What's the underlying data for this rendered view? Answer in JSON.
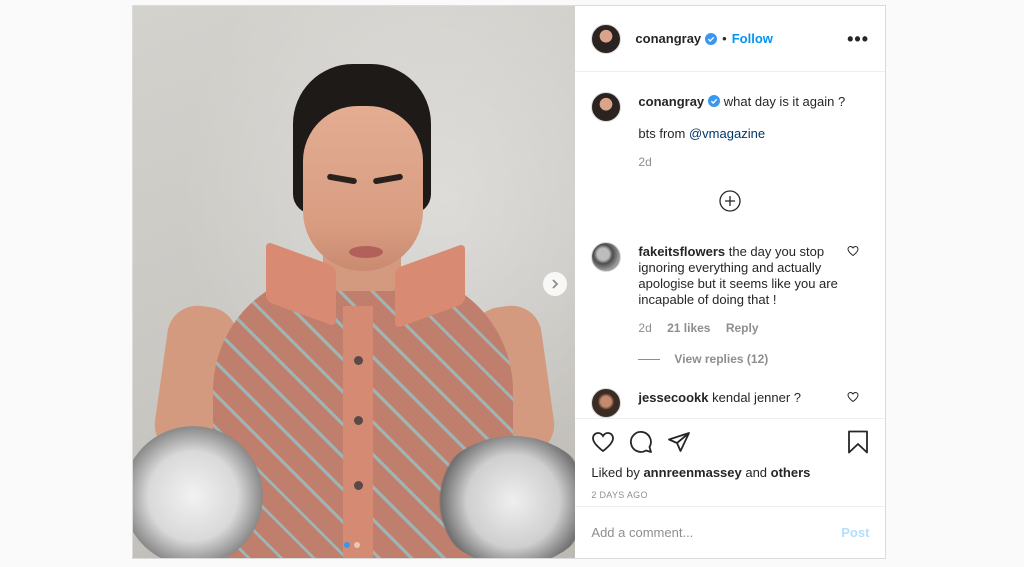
{
  "post": {
    "username": "conangray",
    "follow_label": "Follow",
    "separator": "•",
    "caption_text": "what day is it again ?",
    "caption_line2_prefix": "bts from ",
    "caption_mention": "@vmagazine",
    "caption_time": "2d",
    "carousel": {
      "dots": 2,
      "active_index": 0
    }
  },
  "comments": [
    {
      "username": "fakeitsflowers",
      "text": "the day you stop ignoring everything and actually apologise but it seems like you are incapable of doing that !",
      "time": "2d",
      "likes": "21 likes",
      "reply_label": "Reply",
      "view_replies": "View replies (12)"
    },
    {
      "username": "jessecookk",
      "text": "kendal jenner ?"
    }
  ],
  "footer": {
    "liked_by_prefix": "Liked by ",
    "liked_by_user": "annreenmassey",
    "liked_by_and": " and ",
    "liked_by_others": "others",
    "timestamp": "2 DAYS AGO",
    "comment_placeholder": "Add a comment...",
    "post_label": "Post"
  },
  "colors": {
    "link": "#0095f6",
    "verified": "#3897f0",
    "post_disabled": "#b2dffc"
  },
  "icons": [
    "verified-badge-icon",
    "more-options-icon",
    "heart-icon",
    "comment-icon",
    "share-icon",
    "bookmark-icon",
    "add-circle-icon",
    "chevron-right-icon"
  ]
}
